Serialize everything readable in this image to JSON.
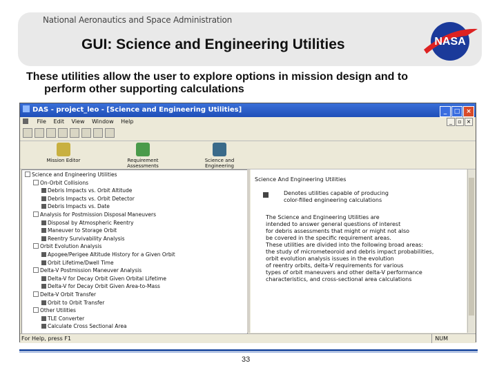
{
  "header": {
    "agency": "National Aeronautics and Space Administration",
    "title": "GUI: Science and Engineering Utilities",
    "logo_text": "NASA"
  },
  "subtitle": {
    "line1": "These utilities allow the user to explore options in mission design and to",
    "line2": "perform other supporting calculations"
  },
  "window": {
    "title": "DAS - project_leo - [Science and Engineering Utilities]",
    "menu": [
      "File",
      "Edit",
      "View",
      "Window",
      "Help"
    ],
    "toolbar_icons": [
      "new-icon",
      "open-icon",
      "save-icon",
      "print-icon",
      "cut-icon",
      "copy-icon",
      "paste-icon",
      "grid-icon"
    ],
    "big_buttons": [
      {
        "label": "Mission Editor",
        "icon": "mission-editor-icon"
      },
      {
        "label": "Requirement Assessments",
        "icon": "requirement-assessments-icon"
      },
      {
        "label": "Science and Engineering",
        "icon": "science-engineering-icon"
      }
    ],
    "tree": [
      {
        "label": "Science and Engineering Utilities",
        "level": 0,
        "type": "root"
      },
      {
        "label": "On-Orbit Collisions",
        "level": 1,
        "type": "folder"
      },
      {
        "label": "Debris Impacts vs. Orbit Altitude",
        "level": 2,
        "type": "leaf"
      },
      {
        "label": "Debris Impacts vs. Orbit Detector",
        "level": 2,
        "type": "leaf"
      },
      {
        "label": "Debris Impacts vs. Date",
        "level": 2,
        "type": "leaf"
      },
      {
        "label": "Analysis for Postmission Disposal Maneuvers",
        "level": 1,
        "type": "folder"
      },
      {
        "label": "Disposal by Atmospheric Reentry",
        "level": 2,
        "type": "leaf"
      },
      {
        "label": "Maneuver to Storage Orbit",
        "level": 2,
        "type": "leaf"
      },
      {
        "label": "Reentry Survivability Analysis",
        "level": 2,
        "type": "leaf"
      },
      {
        "label": "Orbit Evolution Analysis",
        "level": 1,
        "type": "folder"
      },
      {
        "label": "Apogee/Perigee Altitude History for a Given Orbit",
        "level": 2,
        "type": "leaf"
      },
      {
        "label": "Orbit Lifetime/Dwell Time",
        "level": 2,
        "type": "leaf"
      },
      {
        "label": "Delta-V Postmission Maneuver Analysis",
        "level": 1,
        "type": "folder"
      },
      {
        "label": "Delta-V for Decay Orbit Given Orbital Lifetime",
        "level": 2,
        "type": "leaf"
      },
      {
        "label": "Delta-V for Decay Orbit Given Area-to-Mass",
        "level": 2,
        "type": "leaf"
      },
      {
        "label": "Delta-V Orbit Transfer",
        "level": 1,
        "type": "folder"
      },
      {
        "label": "Orbit to Orbit Transfer",
        "level": 2,
        "type": "leaf"
      },
      {
        "label": "Other Utilities",
        "level": 1,
        "type": "folder"
      },
      {
        "label": "TLE Converter",
        "level": 2,
        "type": "leaf"
      },
      {
        "label": "Calculate Cross Sectional Area",
        "level": 2,
        "type": "leaf"
      }
    ],
    "pane": {
      "heading": "Science And Engineering Utilities",
      "desc_lines": [
        "Denotes utilities capable of producing",
        "color-filled engineering calculations"
      ],
      "body_lines": [
        "The Science and Engineering Utilities are",
        "intended to answer general questions of interest",
        "for debris assessments that might or might not also",
        "be covered in the specific requirement areas.",
        "These utilities are divided into the following broad areas:",
        "the study of micrometeoroid and debris impact probabilities,",
        "orbit evolution analysis issues in the evolution",
        "of reentry orbits, delta-V requirements for various",
        "types of orbit maneuvers and other delta-V performance",
        "characteristics, and cross-sectional area calculations"
      ]
    },
    "status": {
      "left": "For Help, press F1",
      "right": "NUM"
    }
  },
  "page_number": "33",
  "colors": {
    "accent": "#2c56a6",
    "titlebar": "#1f4fb8",
    "header_bg": "#e9e9e9"
  }
}
